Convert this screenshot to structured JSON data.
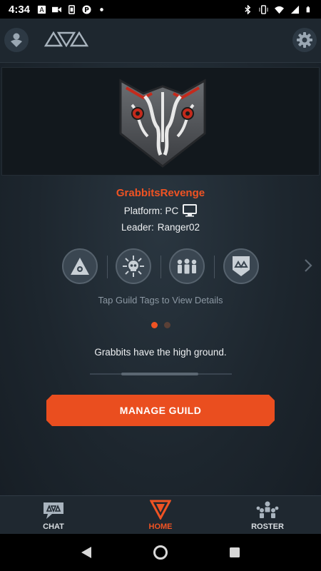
{
  "status_bar": {
    "time": "4:34",
    "left_icons": [
      "a-box-icon",
      "video-icon",
      "battery-saver-icon",
      "p-icon",
      "dot-icon"
    ],
    "right_icons": [
      "bluetooth-icon",
      "vibrate-icon",
      "wifi-icon",
      "signal-icon",
      "battery-icon"
    ]
  },
  "top_bar": {
    "profile_icon": "profile-icon",
    "logo": "triangles-logo",
    "settings_icon": "gear-icon"
  },
  "guild": {
    "name": "GrabbitsRevenge",
    "platform_text": "Platform: PC",
    "platform_icon": "monitor-icon",
    "leader_label": "Leader:",
    "leader_name": "Ranger02",
    "emblem_icon": "skull-emblem",
    "tags": [
      {
        "icon": "triangle-eye-tag-icon"
      },
      {
        "icon": "skull-burst-tag-icon"
      },
      {
        "icon": "group-tag-icon"
      },
      {
        "icon": "badge-shield-tag-icon"
      }
    ],
    "tap_hint": "Tap Guild Tags to View Details",
    "motto": "Grabbits have the high ground.",
    "pager": {
      "current": 1,
      "total": 2
    }
  },
  "actions": {
    "manage_label": "MANAGE GUILD"
  },
  "tabs": [
    {
      "label": "CHAT",
      "icon": "chat-icon",
      "active": false
    },
    {
      "label": "HOME",
      "icon": "home-icon",
      "active": true
    },
    {
      "label": "ROSTER",
      "icon": "roster-icon",
      "active": false
    }
  ],
  "colors": {
    "accent": "#f05323",
    "button": "#ea4e1f",
    "background": "#1d262e"
  }
}
